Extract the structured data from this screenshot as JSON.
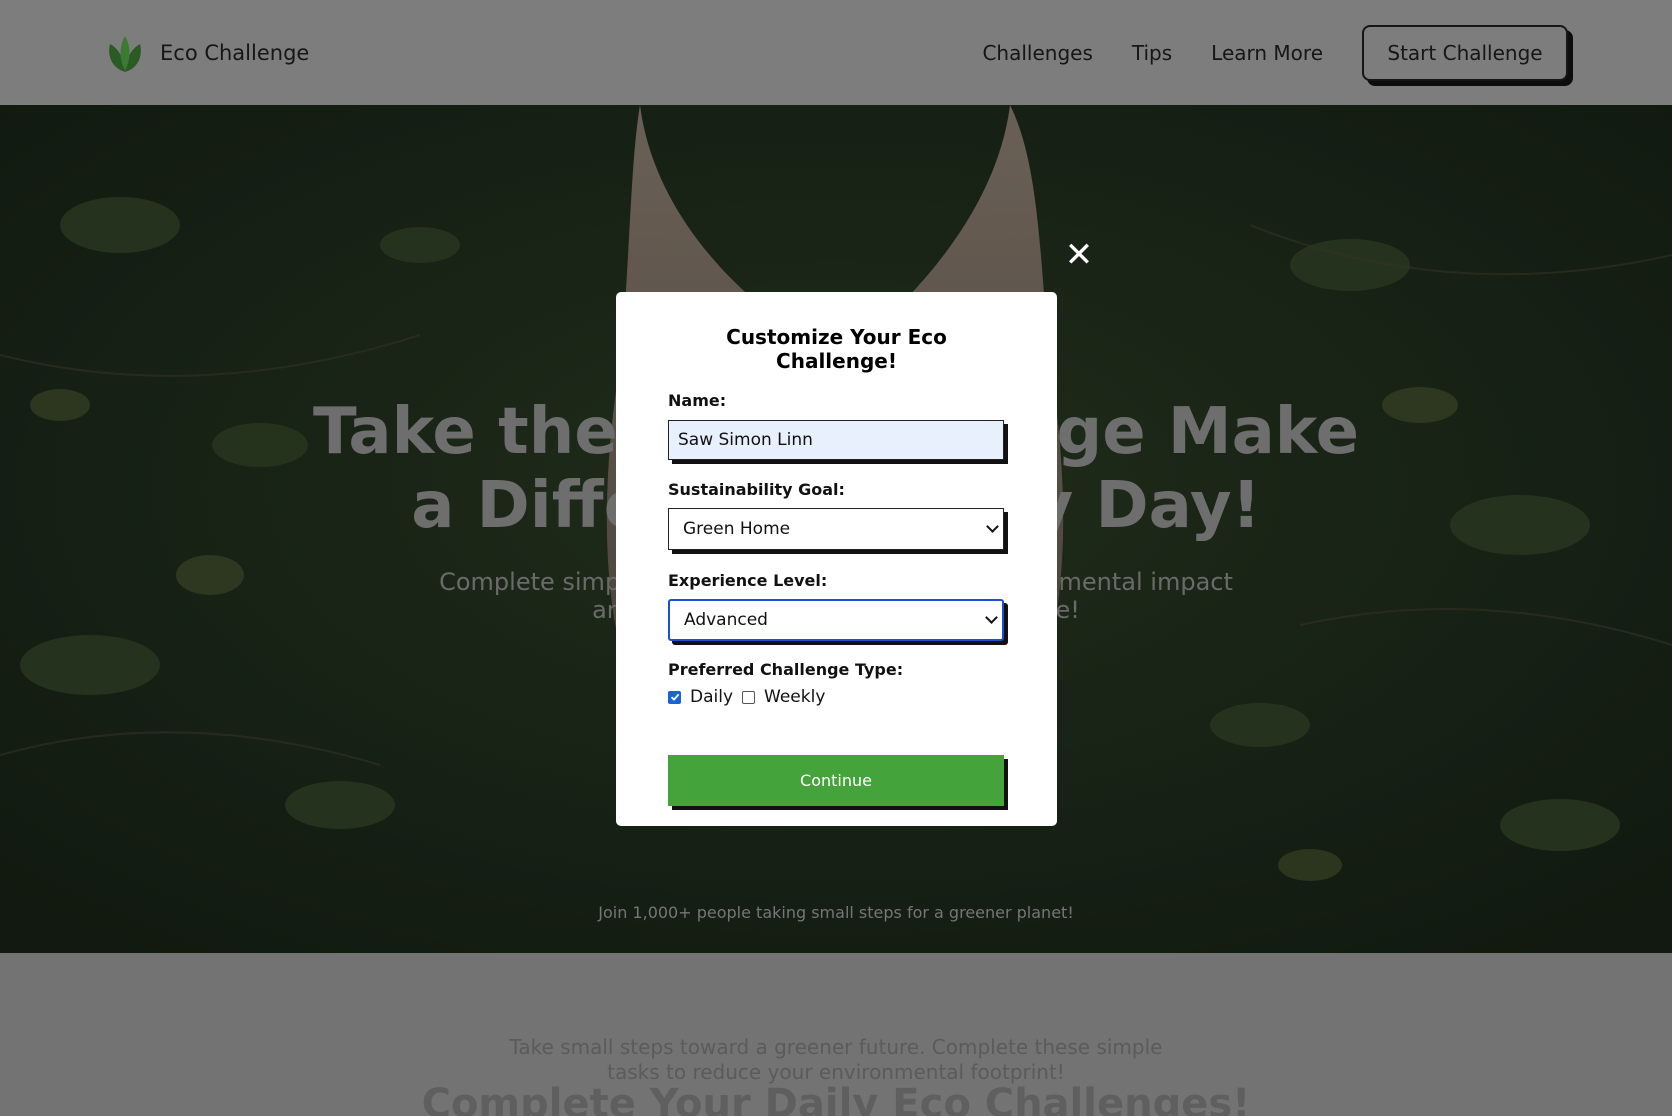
{
  "navbar": {
    "brand": "Eco Challenge",
    "links": [
      "Challenges",
      "Tips",
      "Learn More"
    ],
    "cta": "Start Challenge"
  },
  "hero": {
    "title_line1": "Take the Eco Challenge Make",
    "title_line2": "a Difference Every Day!",
    "subtitle_line1": "Complete simple daily tasks to reduce your environmental impact",
    "subtitle_line2": "and build habits for long-lasting change!",
    "footnote": "Join 1,000+ people taking small steps for a greener planet!"
  },
  "below": {
    "text_line1": "Take small steps toward a greener future. Complete these simple",
    "text_line2": "tasks to reduce your environmental footprint!",
    "heading": "Complete Your Daily Eco Challenges!"
  },
  "modal": {
    "close_symbol": "✕",
    "title": "Customize Your Eco Challenge!",
    "name_label": "Name:",
    "name_value": "Saw Simon Linn",
    "goal_label": "Sustainability Goal:",
    "goal_value": "Green Home",
    "experience_label": "Experience Level:",
    "experience_value": "Advanced",
    "type_label": "Preferred Challenge Type:",
    "type_options": [
      {
        "label": "Daily",
        "checked": true
      },
      {
        "label": "Weekly",
        "checked": false
      }
    ],
    "continue_label": "Continue"
  },
  "colors": {
    "accent_green": "#45a33b",
    "focus_blue": "#1b4fd8",
    "overlay_gray": "#7d7d7d"
  }
}
